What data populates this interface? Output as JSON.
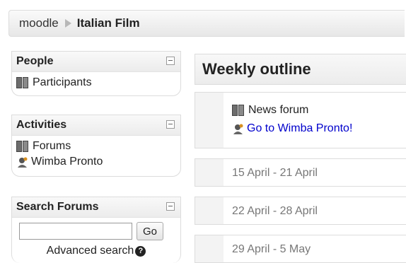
{
  "navbar": {
    "home": "moodle",
    "current": "Italian Film"
  },
  "blocks": {
    "people": {
      "title": "People",
      "items": [
        {
          "label": "Participants",
          "icon": "people-icon"
        }
      ]
    },
    "activities": {
      "title": "Activities",
      "items": [
        {
          "label": "Forums",
          "icon": "people-icon"
        },
        {
          "label": "Wimba Pronto",
          "icon": "wimba-icon"
        }
      ]
    },
    "search": {
      "title": "Search Forums",
      "input_value": "",
      "go_label": "Go",
      "advanced_label": "Advanced search"
    }
  },
  "main": {
    "title": "Weekly outline",
    "section0": {
      "items": [
        {
          "label": "News forum",
          "icon": "people-icon"
        },
        {
          "label": "Go to Wimba Pronto!",
          "icon": "wimba-icon"
        }
      ]
    },
    "weeks": [
      {
        "label": "15 April - 21 April"
      },
      {
        "label": "22 April - 28 April"
      },
      {
        "label": "29 April - 5 May"
      }
    ]
  },
  "colors": {
    "link": "#0000cc",
    "muted": "#777777"
  }
}
